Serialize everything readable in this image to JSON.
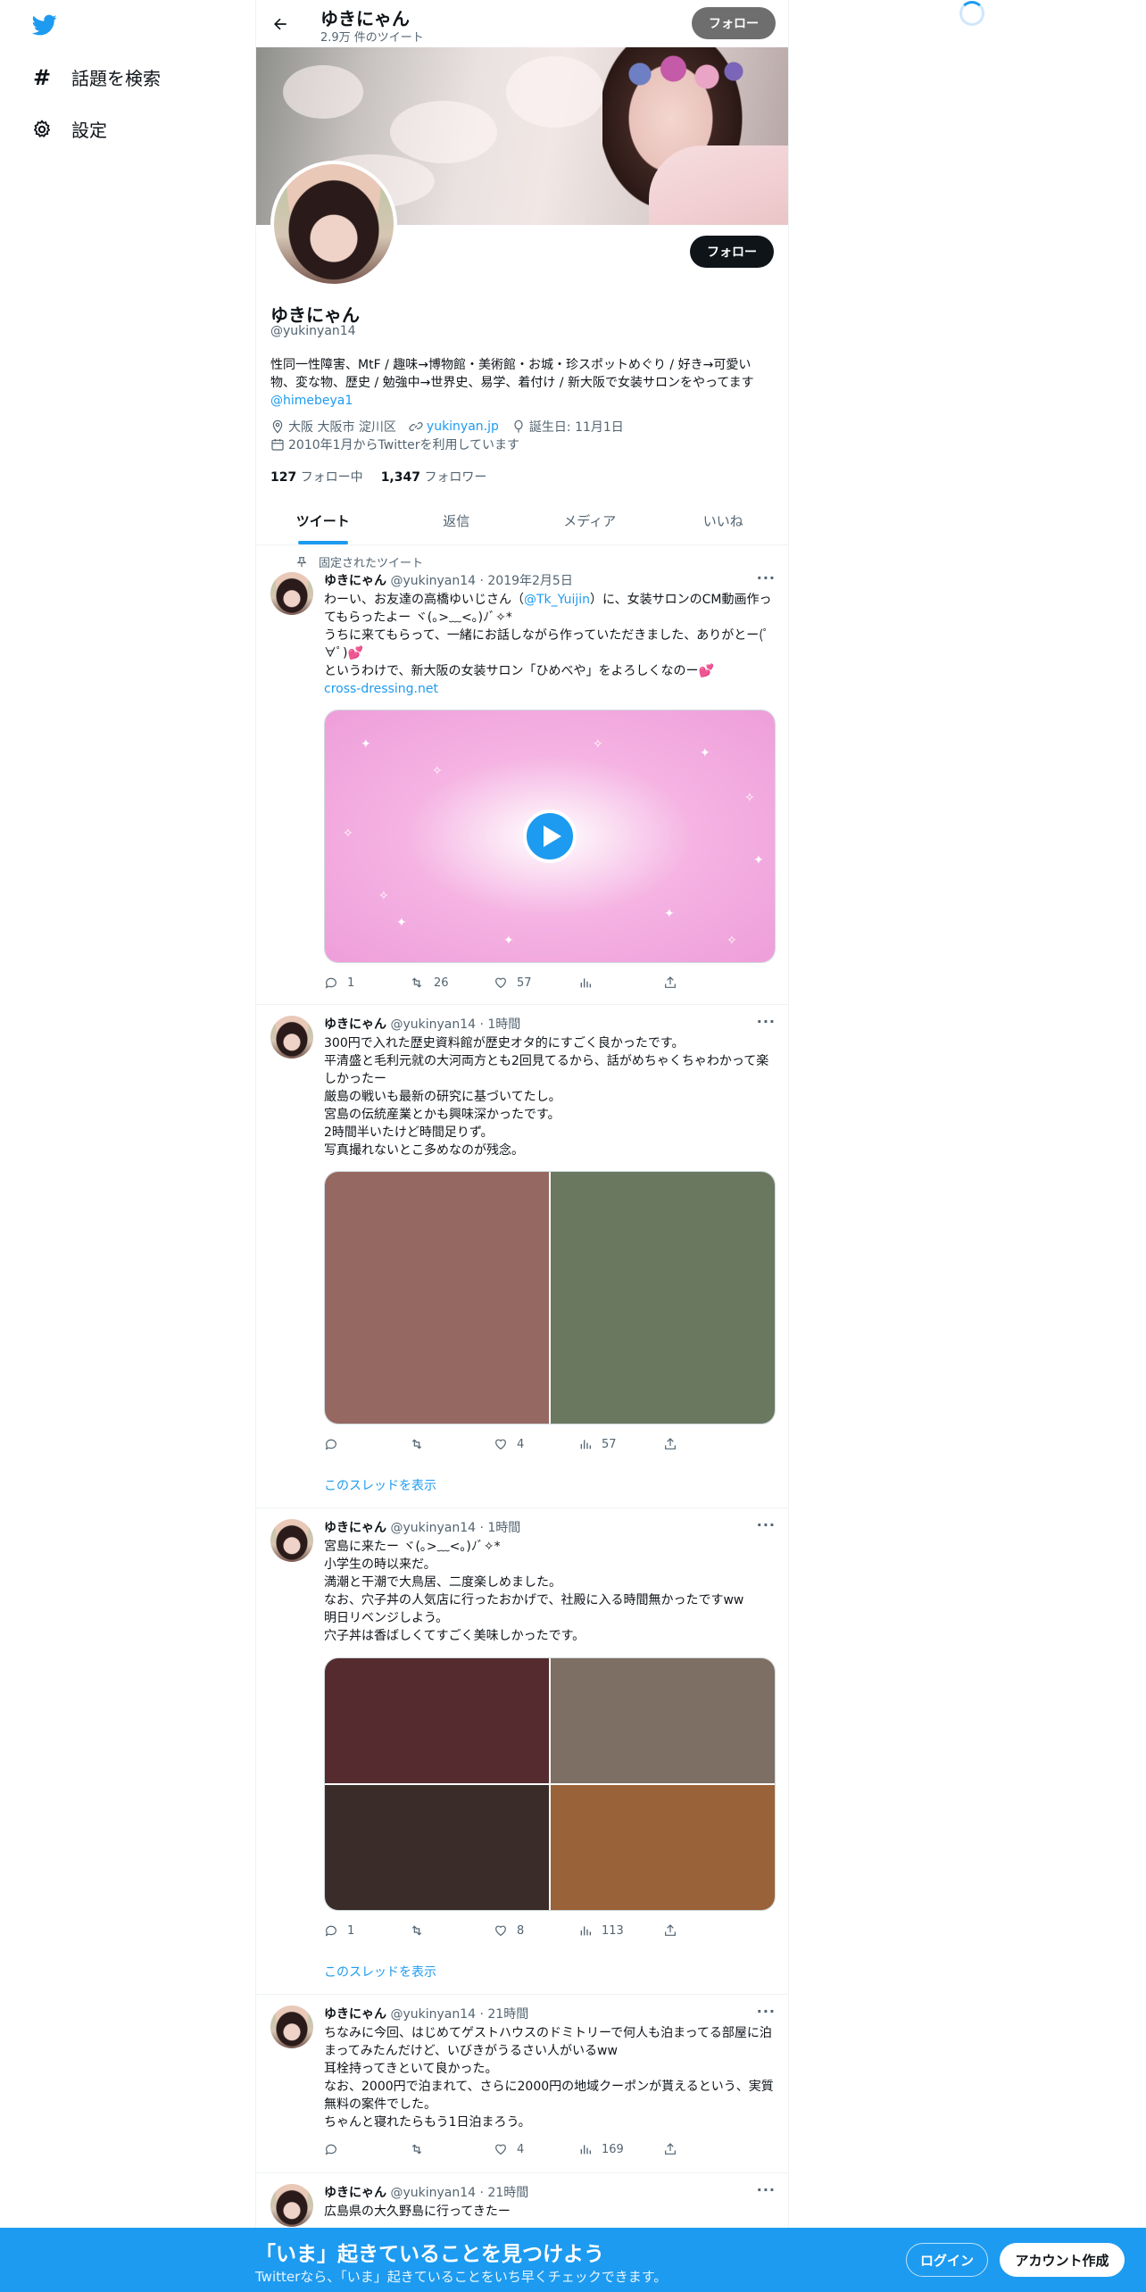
{
  "nav": {
    "explore_label": "話題を検索",
    "settings_label": "設定"
  },
  "header": {
    "name": "ゆきにゃん",
    "tweet_count": "2.9万 件のツイート",
    "follow_label": "フォロー"
  },
  "profile": {
    "follow_label": "フォロー",
    "name": "ゆきにゃん",
    "handle": "@yukinyan14",
    "bio": "性同一性障害、MtF / 趣味→博物館・美術館・お城・珍スポットめぐり / 好き→可愛い物、変な物、歴史 / 勉強中→世界史、易学、着付け / 新大阪で女装サロンをやってます ",
    "bio_link": "@himebeya1",
    "location": "大阪 大阪市 淀川区",
    "website": "yukinyan.jp",
    "birthday": "誕生日: 11月1日",
    "joined": "2010年1月からTwitterを利用しています",
    "following_count": "127",
    "following_label": "フォロー中",
    "followers_count": "1,347",
    "followers_label": "フォロワー"
  },
  "tabs": [
    "ツイート",
    "返信",
    "メディア",
    "いいね"
  ],
  "tweets": [
    {
      "pinned_label": "固定されたツイート",
      "name": "ゆきにゃん",
      "meta": "@yukinyan14 · 2019年2月5日",
      "text_a": "わーい、お友達の高橋ゆいじさん（",
      "mention": "@Tk_Yuijin",
      "text_b": "）に、女装サロンのCM動画作ってもらったよー ヾ(｡>﹏<｡)ﾉﾞ✧*\nうちに来てもらって、一緒にお話しながら作っていただきました、ありがとー(ﾟ∀ﾟ)💕\nというわけで、新大阪の女装サロン「ひめべや」をよろしくなのー💕",
      "link": "cross-dressing.net",
      "replies": "1",
      "retweets": "26",
      "likes": "57",
      "views": ""
    },
    {
      "name": "ゆきにゃん",
      "meta": "@yukinyan14 · 1時間",
      "text": "300円で入れた歴史資料館が歴史オタ的にすごく良かったです。\n平清盛と毛利元就の大河両方とも2回見てるから、話がめちゃくちゃわかって楽しかったー\n厳島の戦いも最新の研究に基づいてたし。\n宮島の伝統産業とかも興味深かったです。\n2時間半いたけど時間足りず。\n写真撮れないとこ多めなのが残念。",
      "replies": "",
      "retweets": "",
      "likes": "4",
      "views": "57",
      "thread_label": "このスレッドを表示"
    },
    {
      "name": "ゆきにゃん",
      "meta": "@yukinyan14 · 1時間",
      "text": "宮島に来たー ヾ(｡>﹏<｡)ﾉﾞ✧*\n小学生の時以来だ。\n満潮と干潮で大鳥居、二度楽しめました。\nなお、穴子丼の人気店に行ったおかげで、社殿に入る時間無かったですww\n明日リベンジしよう。\n穴子丼は香ばしくてすごく美味しかったです。",
      "replies": "1",
      "retweets": "",
      "likes": "8",
      "views": "113",
      "thread_label": "このスレッドを表示"
    },
    {
      "name": "ゆきにゃん",
      "meta": "@yukinyan14 · 21時間",
      "text": "ちなみに今回、はじめてゲストハウスのドミトリーで何人も泊まってる部屋に泊まってみたんだけど、いびきがうるさい人がいるww\n耳栓持ってきといて良かった。\nなお、2000円で泊まれて、さらに2000円の地域クーポンが貰えるという、実質無料の案件でした。\nちゃんと寝れたらもう1日泊まろう。",
      "replies": "",
      "retweets": "",
      "likes": "4",
      "views": "169"
    },
    {
      "name": "ゆきにゃん",
      "meta": "@yukinyan14 · 21時間",
      "text": "広島県の大久野島に行ってきたー"
    }
  ],
  "bottom": {
    "title": "「いま」起きていることを見つけよう",
    "subtitle": "Twitterなら、「いま」起きていることをいち早くチェックできます。",
    "login_label": "ログイン",
    "signup_label": "アカウント作成"
  },
  "colors": {
    "accent": "#1d9bf0",
    "text": "#0f1419",
    "muted": "#536471"
  },
  "icons": [
    "twitter-logo-icon",
    "hashtag-icon",
    "gear-icon",
    "back-arrow-icon",
    "location-icon",
    "link-icon",
    "balloon-icon",
    "calendar-icon",
    "pin-icon",
    "reply-icon",
    "retweet-icon",
    "like-icon",
    "views-icon",
    "share-icon",
    "more-icon",
    "play-icon"
  ]
}
